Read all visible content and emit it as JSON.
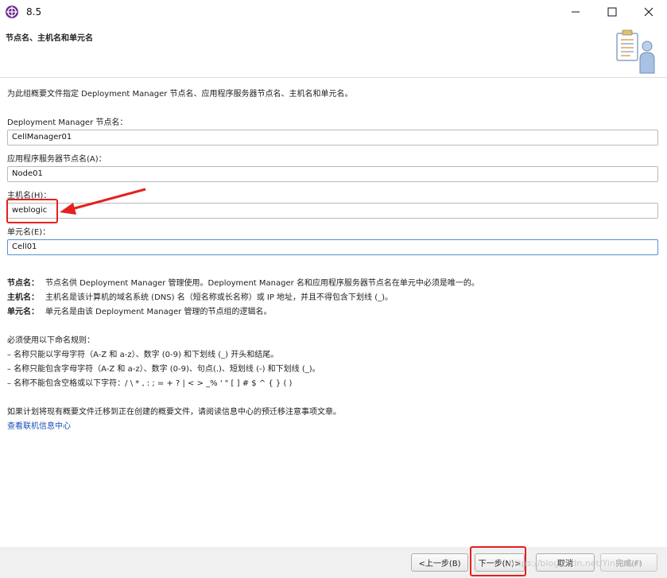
{
  "window": {
    "title": "8.5"
  },
  "header": {
    "title": "节点名、主机名和单元名"
  },
  "intro": "为此组概要文件指定 Deployment Manager 节点名、应用程序服务器节点名、主机名和单元名。",
  "fields": [
    {
      "label": "Deployment Manager 节点名：",
      "value": "CellManager01"
    },
    {
      "label": "应用程序服务器节点名(A)：",
      "value": "Node01"
    },
    {
      "label": "主机名(H)：",
      "value": "weblogic"
    },
    {
      "label": "单元名(E)：",
      "value": "Cell01"
    }
  ],
  "definitions": [
    {
      "term": "节点名：",
      "text": "节点名供 Deployment Manager 管理使用。Deployment Manager 名和应用程序服务器节点名在单元中必须是唯一的。"
    },
    {
      "term": "主机名：",
      "text": "主机名是该计算机的域名系统 (DNS) 名（短名称或长名称）或 IP 地址，并且不得包含下划线 (_)。"
    },
    {
      "term": "单元名：",
      "text": "单元名是由该 Deployment Manager 管理的节点组的逻辑名。"
    }
  ],
  "rules": {
    "heading": "必须使用以下命名规则：",
    "items": [
      "–  名称只能以字母字符（A-Z 和 a-z）、数字 (0-9) 和下划线 (_) 开头和结尾。",
      "–  名称只能包含字母字符（A-Z 和 a-z）、数字 (0-9)、句点(.)、短划线 (-) 和下划线 (_)。",
      "–  名称不能包含空格或以下字符：/ \\ * , : ; = + ? | < > _% ' \" [ ] # $ ^ { } ( )"
    ]
  },
  "migration_note": "如果计划将现有概要文件迁移到正在创建的概要文件，请阅读信息中心的预迁移注意事项文章。",
  "info_link": "查看联机信息中心",
  "buttons": {
    "back": "<上一步(B)",
    "next": "下一步(N)>",
    "cancel": "取消",
    "finish": "完成(F)"
  },
  "watermark": "https://blog.csdn.net/Yinnewei",
  "colors": {
    "highlight": "#e5201e",
    "link": "#1a4fb8"
  }
}
